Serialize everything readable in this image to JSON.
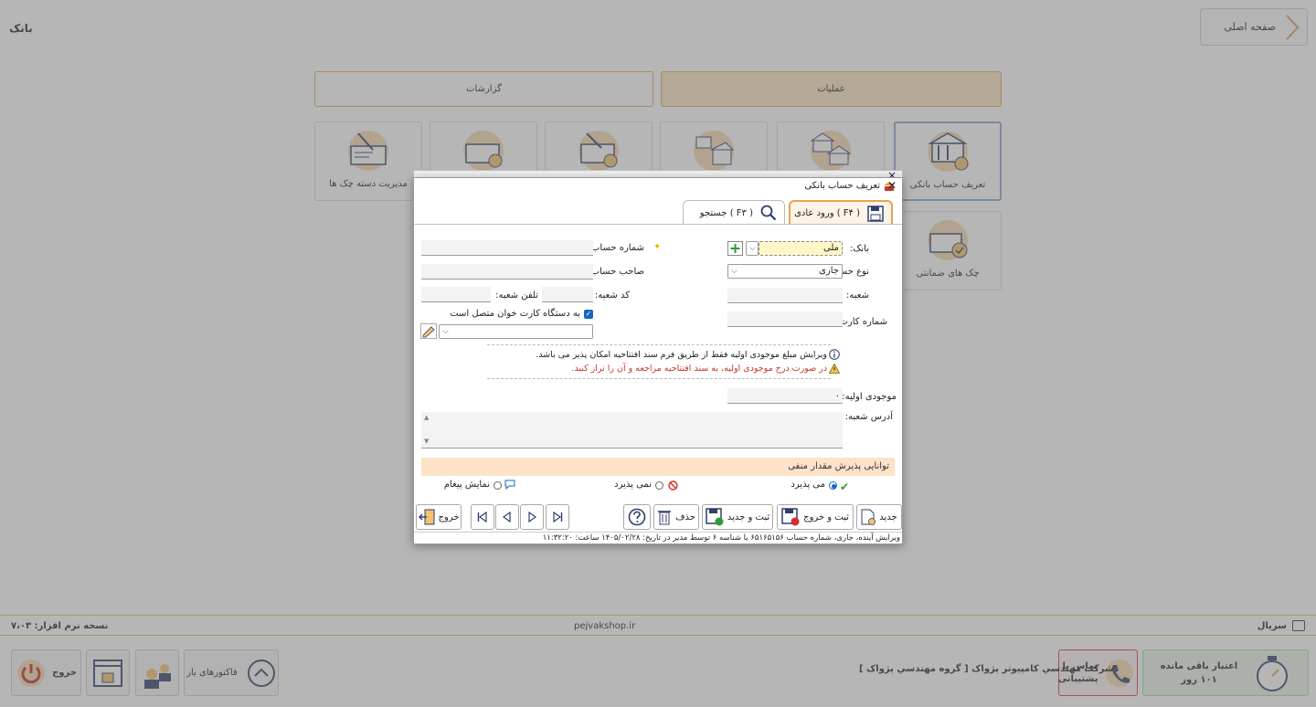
{
  "app": {
    "title": "بانک",
    "home_label": "صفحه اصلی",
    "tabs": {
      "reports": "گزارشات",
      "operations": "عملیات"
    },
    "tiles": {
      "define_bank_account": "تعریف حساب بانکی",
      "check_book_management": "مدیریت دسته چک ها",
      "guarantee_checks": "چک های ضمانتی"
    },
    "footer": {
      "serial": "سریال",
      "website": "pejvakshop.ir",
      "version": "نسخه نرم افزار: ۷،۰۳",
      "company": "شرکت مهندسي كامپيوتر پژواک [ گروه مهندسي پژواک ]",
      "credit_label": "اعتبار باقی مانده",
      "credit_days": "۱۰۱ روز",
      "support_label": "تماس با پشتیبانی",
      "open_invoices": "فاکتورهای باز",
      "exit": "خروج"
    }
  },
  "dialog": {
    "title": "تعریف حساب بانکی",
    "tab_normal": "ورود عادی ( F۴ )",
    "tab_search": "جستجو ( F۳ )",
    "labels": {
      "bank": "بانک:",
      "account_number": "شماره حساب:",
      "account_type": "نوع حساب:",
      "account_owner": "صاحب حساب:",
      "branch": "شعبه:",
      "branch_code": "کد شعبه:",
      "branch_phone": "تلفن شعبه:",
      "card_number": "شماره کارت:",
      "card_reader": "به دستگاه کارت خوان متصل است",
      "initial_balance": "موجودی اولیه:",
      "branch_address": "آدرس شعبه:"
    },
    "values": {
      "bank": "ملی",
      "account_type": "جاری",
      "initial_balance": "۰"
    },
    "notices": {
      "info": "ویرایش مبلغ موجودی اولیه فقط از طریق فرم سند افتتاحیه امکان پذیر می باشد.",
      "warning": "در صورت درج موجودی اولیه، به سند افتتاحیه مراجعه و آن را تراز کنید."
    },
    "negative_title": "توانایی پذیرش مقدار منفی",
    "radios": {
      "accepts": "می پذیرد",
      "not_accepts": "نمی پذیرد",
      "show_message": "نمایش پیغام"
    },
    "buttons": {
      "new": "جدید",
      "save_exit": "ثبت و خروج",
      "save_new": "ثبت و جدید",
      "delete": "حذف",
      "exit": "خروج"
    },
    "status": "ویرایش آینده، جاری، شماره حساب ۶۵۱۶۵۱۵۶ با شناسه ۶ توسط مدیر در تاریخ: ۱۴۰۵/۰۲/۲۸ ساعت: ۱۱:۳۲:۲۰"
  },
  "colors": {
    "accent": "#e7a44c",
    "tab_active": "#fbe2bf",
    "icon_circle": "#f6d9b0",
    "icon_blue": "#2f3f6b"
  }
}
